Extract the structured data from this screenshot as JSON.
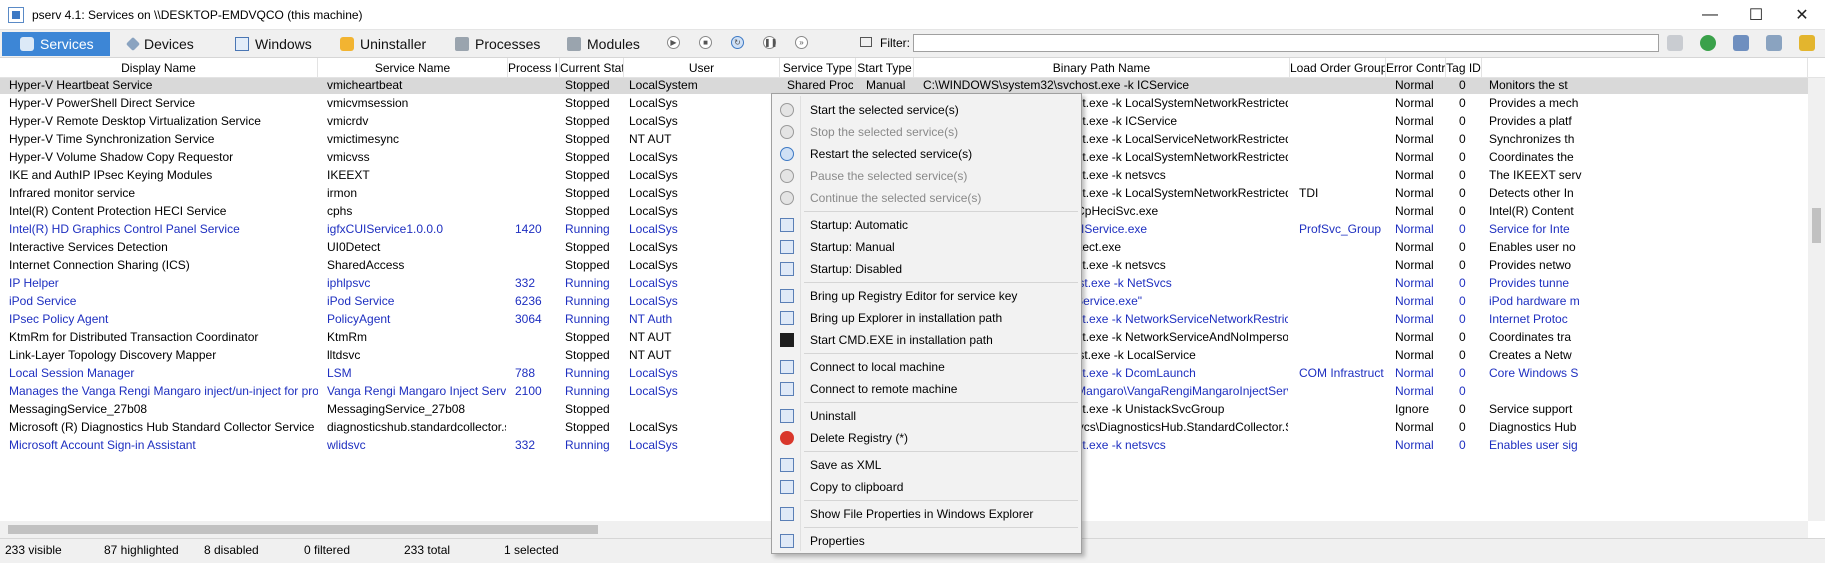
{
  "window": {
    "title": "pserv 4.1: Services on \\\\DESKTOP-EMDVQCO (this machine)",
    "minimize": "—",
    "maximize": "☐",
    "close": "✕"
  },
  "tabs": [
    {
      "label": "Services",
      "icon": "gear-icon"
    },
    {
      "label": "Devices",
      "icon": "wrench-icon"
    },
    {
      "label": "Windows",
      "icon": "window-icon"
    },
    {
      "label": "Uninstaller",
      "icon": "package-icon"
    },
    {
      "label": "Processes",
      "icon": "process-icon"
    },
    {
      "label": "Modules",
      "icon": "module-icon"
    }
  ],
  "filter": {
    "label": "Filter:",
    "value": ""
  },
  "columns": [
    "Display Name",
    "Service Name",
    "Process ID",
    "Current State",
    "User",
    "Service Type",
    "Start Type",
    "Binary Path Name",
    "Load Order Group",
    "Error Control",
    "Tag ID",
    ""
  ],
  "rows": [
    {
      "display": "Hyper-V Heartbeat Service",
      "service": "vmicheartbeat",
      "pid": "",
      "state": "Stopped",
      "user": "LocalSystem",
      "type": "Shared Process",
      "start": "Manual",
      "path": "C:\\WINDOWS\\system32\\svchost.exe -k ICService",
      "group": "",
      "error": "Normal",
      "tag": "0",
      "desc": "Monitors the st",
      "running": false,
      "selected": true
    },
    {
      "display": "Hyper-V PowerShell Direct Service",
      "service": "vmicvmsession",
      "pid": "",
      "state": "Stopped",
      "user": "LocalSys",
      "type": "",
      "start": "",
      "path": "\\WINDOWS\\system32\\svchost.exe -k LocalSystemNetworkRestricted",
      "group": "",
      "error": "Normal",
      "tag": "0",
      "desc": "Provides a mech",
      "running": false
    },
    {
      "display": "Hyper-V Remote Desktop Virtualization Service",
      "service": "vmicrdv",
      "pid": "",
      "state": "Stopped",
      "user": "LocalSys",
      "type": "",
      "start": "",
      "path": "\\WINDOWS\\system32\\svchost.exe -k ICService",
      "group": "",
      "error": "Normal",
      "tag": "0",
      "desc": "Provides a platf",
      "running": false
    },
    {
      "display": "Hyper-V Time Synchronization Service",
      "service": "vmictimesync",
      "pid": "",
      "state": "Stopped",
      "user": "NT AUT",
      "type": "",
      "start": "",
      "path": "\\WINDOWS\\system32\\svchost.exe -k LocalServiceNetworkRestricted",
      "group": "",
      "error": "Normal",
      "tag": "0",
      "desc": "Synchronizes th",
      "running": false
    },
    {
      "display": "Hyper-V Volume Shadow Copy Requestor",
      "service": "vmicvss",
      "pid": "",
      "state": "Stopped",
      "user": "LocalSys",
      "type": "",
      "start": "",
      "path": "\\WINDOWS\\system32\\svchost.exe -k LocalSystemNetworkRestricted",
      "group": "",
      "error": "Normal",
      "tag": "0",
      "desc": "Coordinates the",
      "running": false
    },
    {
      "display": "IKE and AuthIP IPsec Keying Modules",
      "service": "IKEEXT",
      "pid": "",
      "state": "Stopped",
      "user": "LocalSys",
      "type": "",
      "start": "",
      "path": "\\WINDOWS\\system32\\svchost.exe -k netsvcs",
      "group": "",
      "error": "Normal",
      "tag": "0",
      "desc": "The IKEEXT serv",
      "running": false
    },
    {
      "display": "Infrared monitor service",
      "service": "irmon",
      "pid": "",
      "state": "Stopped",
      "user": "LocalSys",
      "type": "",
      "start": "",
      "path": "\\WINDOWS\\system32\\svchost.exe -k LocalSystemNetworkRestricted",
      "group": "TDI",
      "error": "Normal",
      "tag": "0",
      "desc": "Detects other In",
      "running": false
    },
    {
      "display": "Intel(R) Content Protection HECI Service",
      "service": "cphs",
      "pid": "",
      "state": "Stopped",
      "user": "LocalSys",
      "type": "",
      "start": "",
      "path": "\\WINDOWS\\SysWow64\\IntelCpHeciSvc.exe",
      "group": "",
      "error": "Normal",
      "tag": "0",
      "desc": "Intel(R) Content",
      "running": false
    },
    {
      "display": "Intel(R) HD Graphics Control Panel Service",
      "service": "igfxCUIService1.0.0.0",
      "pid": "1420",
      "state": "Running",
      "user": "LocalSys",
      "type": "",
      "start": "",
      "path": "\\WINDOWS\\system32\\igfxCUIService.exe",
      "group": "ProfSvc_Group",
      "error": "Normal",
      "tag": "0",
      "desc": "Service for Inte",
      "running": true
    },
    {
      "display": "Interactive Services Detection",
      "service": "UI0Detect",
      "pid": "",
      "state": "Stopped",
      "user": "LocalSys",
      "type": "",
      "start": "",
      "path": "\\WINDOWS\\system32\\UI0Detect.exe",
      "group": "",
      "error": "Normal",
      "tag": "0",
      "desc": "Enables user no",
      "running": false
    },
    {
      "display": "Internet Connection Sharing (ICS)",
      "service": "SharedAccess",
      "pid": "",
      "state": "Stopped",
      "user": "LocalSys",
      "type": "",
      "start": "",
      "path": "\\WINDOWS\\system32\\svchost.exe -k netsvcs",
      "group": "",
      "error": "Normal",
      "tag": "0",
      "desc": "Provides netwo",
      "running": false
    },
    {
      "display": "IP Helper",
      "service": "iphlpsvc",
      "pid": "332",
      "state": "Running",
      "user": "LocalSys",
      "type": "",
      "start": "",
      "path": "\\WINDOWS\\System32\\svchost.exe -k NetSvcs",
      "group": "",
      "error": "Normal",
      "tag": "0",
      "desc": "Provides tunne",
      "running": true
    },
    {
      "display": "iPod Service",
      "service": "iPod Service",
      "pid": "6236",
      "state": "Running",
      "user": "LocalSys",
      "type": "",
      "start": "",
      "path": "\\Program Files\\iPod\\bin\\iPodService.exe\"",
      "group": "",
      "error": "Normal",
      "tag": "0",
      "desc": "iPod hardware m",
      "running": true
    },
    {
      "display": "IPsec Policy Agent",
      "service": "PolicyAgent",
      "pid": "3064",
      "state": "Running",
      "user": "NT Auth",
      "type": "",
      "start": "",
      "path": "\\WINDOWS\\system32\\svchost.exe -k NetworkServiceNetworkRestricted",
      "group": "",
      "error": "Normal",
      "tag": "0",
      "desc": "Internet Protoc",
      "running": true
    },
    {
      "display": "KtmRm for Distributed Transaction Coordinator",
      "service": "KtmRm",
      "pid": "",
      "state": "Stopped",
      "user": "NT AUT",
      "type": "",
      "start": "",
      "path": "\\WINDOWS\\system32\\svchost.exe -k NetworkServiceAndNoImpersonation",
      "group": "",
      "error": "Normal",
      "tag": "0",
      "desc": "Coordinates tra",
      "running": false
    },
    {
      "display": "Link-Layer Topology Discovery Mapper",
      "service": "lltdsvc",
      "pid": "",
      "state": "Stopped",
      "user": "NT AUT",
      "type": "",
      "start": "",
      "path": "\\WINDOWS\\System32\\svchost.exe -k LocalService",
      "group": "",
      "error": "Normal",
      "tag": "0",
      "desc": "Creates a Netw",
      "running": false
    },
    {
      "display": "Local Session Manager",
      "service": "LSM",
      "pid": "788",
      "state": "Running",
      "user": "LocalSys",
      "type": "",
      "start": "",
      "path": "\\WINDOWS\\system32\\svchost.exe -k DcomLaunch",
      "group": "COM Infrastructure",
      "error": "Normal",
      "tag": "0",
      "desc": "Core Windows S",
      "running": true
    },
    {
      "display": "Manages the Vanga Rengi Mangaro inject/un-inject for processes.",
      "service": "Vanga Rengi Mangaro Inject Service",
      "pid": "2100",
      "state": "Running",
      "user": "LocalSys",
      "type": "",
      "start": "",
      "path": "\\Program Files\\Vanga Rengi Mangaro\\VangaRengiMangaroInjectService.exe",
      "group": "",
      "error": "Normal",
      "tag": "0",
      "desc": "",
      "running": true
    },
    {
      "display": "MessagingService_27b08",
      "service": "MessagingService_27b08",
      "pid": "",
      "state": "Stopped",
      "user": "",
      "type": "",
      "start": "",
      "path": "\\WINDOWS\\system32\\svchost.exe -k UnistackSvcGroup",
      "group": "",
      "error": "Ignore",
      "tag": "0",
      "desc": "Service support",
      "running": false
    },
    {
      "display": "Microsoft (R) Diagnostics Hub Standard Collector Service",
      "service": "diagnosticshub.standardcollector.service",
      "pid": "",
      "state": "Stopped",
      "user": "LocalSys",
      "type": "",
      "start": "",
      "path": "\\WINDOWS\\system32\\DiagSvcs\\DiagnosticsHub.StandardCollector.Service.exe",
      "group": "",
      "error": "Normal",
      "tag": "0",
      "desc": "Diagnostics Hub",
      "running": false
    },
    {
      "display": "Microsoft Account Sign-in Assistant",
      "service": "wlidsvc",
      "pid": "332",
      "state": "Running",
      "user": "LocalSys",
      "type": "",
      "start": "",
      "path": "\\WINDOWS\\system32\\svchost.exe -k netsvcs",
      "group": "",
      "error": "Normal",
      "tag": "0",
      "desc": "Enables user sig",
      "running": true
    }
  ],
  "context_menu": [
    {
      "label": "Start the selected service(s)",
      "icon": "play-icon",
      "disabled": false
    },
    {
      "label": "Stop the selected service(s)",
      "icon": "stop-icon",
      "disabled": true
    },
    {
      "label": "Restart the selected service(s)",
      "icon": "restart-icon",
      "disabled": false
    },
    {
      "label": "Pause the selected service(s)",
      "icon": "pause-icon",
      "disabled": true
    },
    {
      "label": "Continue the selected service(s)",
      "icon": "continue-icon",
      "disabled": true
    },
    {
      "label": "Startup: Automatic",
      "icon": "startup-automatic-icon",
      "disabled": false
    },
    {
      "label": "Startup: Manual",
      "icon": "startup-manual-icon",
      "disabled": false
    },
    {
      "label": "Startup: Disabled",
      "icon": "startup-disabled-icon",
      "disabled": false
    },
    {
      "label": "Bring up Registry Editor for service key",
      "icon": "registry-icon",
      "disabled": false
    },
    {
      "label": "Bring up Explorer in installation path",
      "icon": "folder-icon",
      "disabled": false
    },
    {
      "label": "Start CMD.EXE in installation path",
      "icon": "cmd-icon",
      "disabled": false
    },
    {
      "label": "Connect to local machine",
      "icon": "computer-icon",
      "disabled": false
    },
    {
      "label": "Connect to remote machine",
      "icon": "remote-computer-icon",
      "disabled": false
    },
    {
      "label": "Uninstall",
      "icon": "uninstall-icon",
      "disabled": false
    },
    {
      "label": "Delete Registry (*)",
      "icon": "delete-icon",
      "disabled": false
    },
    {
      "label": "Save as XML",
      "icon": "save-icon",
      "disabled": false
    },
    {
      "label": "Copy to clipboard",
      "icon": "clipboard-icon",
      "disabled": false
    },
    {
      "label": "Show File Properties in Windows Explorer",
      "icon": "file-properties-icon",
      "disabled": false
    },
    {
      "label": "Properties",
      "icon": "properties-icon",
      "disabled": false
    }
  ],
  "status": {
    "visible": "233 visible",
    "highlighted": "87 highlighted",
    "disabled": "8 disabled",
    "filtered": "0 filtered",
    "total": "233 total",
    "selected": "1 selected"
  },
  "colors": {
    "running_text": "#1e2fc0",
    "active_tab": "#3d86d6",
    "selection": "#d9d9d9"
  }
}
